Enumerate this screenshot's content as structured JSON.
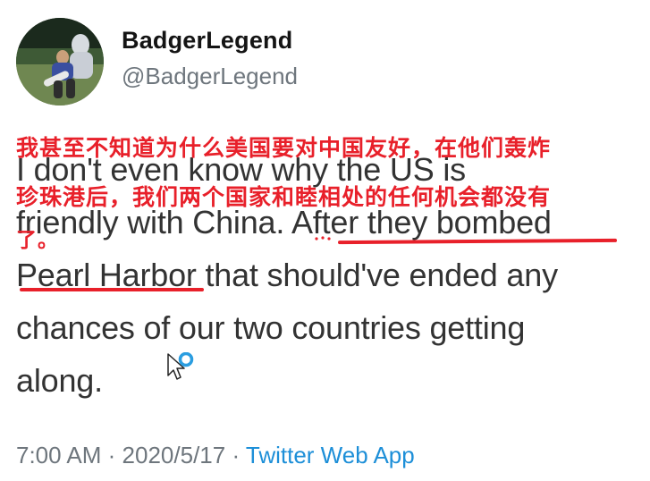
{
  "profile": {
    "display_name": "BadgerLegend",
    "handle": "@BadgerLegend"
  },
  "tweet": {
    "lines": [
      "I don't even know why the US is",
      "friendly with China. After they bombed",
      "Pearl Harbor that should've ended any",
      "chances of our two countries getting",
      "along."
    ]
  },
  "overlay": {
    "chinese_lines": [
      "我甚至不知道为什么美国要对中国友好，在他们轰炸",
      "珍珠港后，我们两个国家和睦相处的任何机会都没有",
      "了。"
    ],
    "color": "#e8202a"
  },
  "meta": {
    "time": "7:00 AM",
    "separator": "·",
    "date": "2020/5/17",
    "source": "Twitter Web App"
  },
  "colors": {
    "link": "#1d8fd8",
    "secondary_text": "#6e767d",
    "annotation_red": "#e8202a"
  },
  "icons": {
    "cursor": "mouse-pointer-busy-icon"
  }
}
